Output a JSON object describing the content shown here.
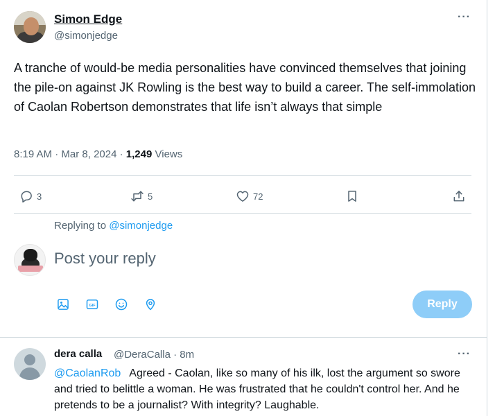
{
  "tweet": {
    "author_name": "Simon Edge",
    "author_handle": "@simonjedge",
    "more_label": "···",
    "text": "A tranche of would-be media personalities have convinced themselves that joining the pile-on against JK Rowling is the best way to build a career. The self-immolation of Caolan Robertson demonstrates that life isn’t always that simple",
    "time": "8:19 AM",
    "date": "Mar 8, 2024",
    "views_count": "1,249",
    "views_label": "Views",
    "actions": {
      "reply_count": "3",
      "retweet_count": "5",
      "like_count": "72"
    }
  },
  "composer": {
    "replying_prefix": "Replying to",
    "replying_handle": "@simonjedge",
    "placeholder": "Post your reply",
    "reply_button": "Reply"
  },
  "comment": {
    "name": "dera calla",
    "handle": "@DeraCalla",
    "time": "8m",
    "more_label": "···",
    "mention": "@CaolanRob",
    "text": "Agreed - Caolan, like so many of his ilk, lost the argument so swore and tried to belittle a woman. He was frustrated that he couldn't control her. And he pretends to be a journalist? With integrity? Laughable."
  },
  "colors": {
    "accent": "#1d9bf0",
    "reply_button_disabled": "#8ecdf8",
    "secondary_text": "#536471",
    "border": "#cfd9de"
  },
  "icons": [
    "reply-icon",
    "retweet-icon",
    "like-icon",
    "bookmark-icon",
    "share-icon",
    "image-icon",
    "gif-icon",
    "emoji-icon",
    "location-icon"
  ]
}
